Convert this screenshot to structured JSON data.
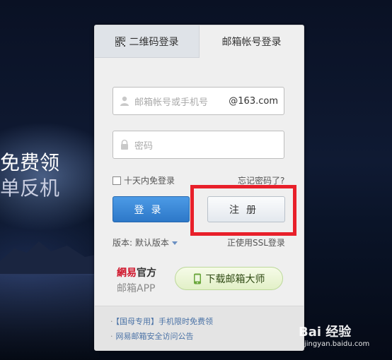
{
  "promo": {
    "line1": "免费领",
    "line2": "单反机"
  },
  "tabs": {
    "qr_label": "二维码登录",
    "mail_label": "邮箱帐号登录"
  },
  "login_form": {
    "account_placeholder": "邮箱帐号或手机号",
    "domain_suffix": "@163.com",
    "password_placeholder": "密码",
    "remember_label": "十天内免登录",
    "forgot_label": "忘记密码了?",
    "login_button": "登录",
    "register_button": "注册",
    "version_label": "版本: 默认版本",
    "ssl_label": "正使用SSL登录"
  },
  "app_promo": {
    "brand": "網易",
    "official": "官方",
    "app_name": "邮箱APP",
    "download_button": "下载邮箱大师"
  },
  "footer_links": [
    "【国母专用】手机限时免费领",
    "网易邮箱安全访问公告"
  ],
  "watermark": {
    "title": "Bai 经验",
    "subtitle": "jingyan.baidu.com"
  },
  "colors": {
    "accent_blue": "#2d78c8",
    "highlight_red": "#e8202a",
    "brand_red": "#d0152b"
  },
  "icons": [
    "qr-code-icon",
    "user-icon",
    "lock-icon",
    "phone-icon",
    "dropdown-triangle-icon",
    "paw-icon"
  ]
}
